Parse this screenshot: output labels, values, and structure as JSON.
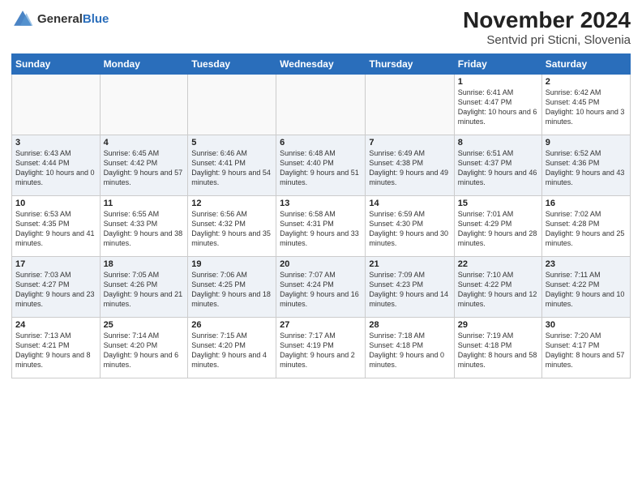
{
  "header": {
    "logo_general": "General",
    "logo_blue": "Blue",
    "title": "November 2024",
    "subtitle": "Sentvid pri Sticni, Slovenia"
  },
  "days_of_week": [
    "Sunday",
    "Monday",
    "Tuesday",
    "Wednesday",
    "Thursday",
    "Friday",
    "Saturday"
  ],
  "weeks": [
    [
      {
        "day": "",
        "info": ""
      },
      {
        "day": "",
        "info": ""
      },
      {
        "day": "",
        "info": ""
      },
      {
        "day": "",
        "info": ""
      },
      {
        "day": "",
        "info": ""
      },
      {
        "day": "1",
        "info": "Sunrise: 6:41 AM\nSunset: 4:47 PM\nDaylight: 10 hours and 6 minutes."
      },
      {
        "day": "2",
        "info": "Sunrise: 6:42 AM\nSunset: 4:45 PM\nDaylight: 10 hours and 3 minutes."
      }
    ],
    [
      {
        "day": "3",
        "info": "Sunrise: 6:43 AM\nSunset: 4:44 PM\nDaylight: 10 hours and 0 minutes."
      },
      {
        "day": "4",
        "info": "Sunrise: 6:45 AM\nSunset: 4:42 PM\nDaylight: 9 hours and 57 minutes."
      },
      {
        "day": "5",
        "info": "Sunrise: 6:46 AM\nSunset: 4:41 PM\nDaylight: 9 hours and 54 minutes."
      },
      {
        "day": "6",
        "info": "Sunrise: 6:48 AM\nSunset: 4:40 PM\nDaylight: 9 hours and 51 minutes."
      },
      {
        "day": "7",
        "info": "Sunrise: 6:49 AM\nSunset: 4:38 PM\nDaylight: 9 hours and 49 minutes."
      },
      {
        "day": "8",
        "info": "Sunrise: 6:51 AM\nSunset: 4:37 PM\nDaylight: 9 hours and 46 minutes."
      },
      {
        "day": "9",
        "info": "Sunrise: 6:52 AM\nSunset: 4:36 PM\nDaylight: 9 hours and 43 minutes."
      }
    ],
    [
      {
        "day": "10",
        "info": "Sunrise: 6:53 AM\nSunset: 4:35 PM\nDaylight: 9 hours and 41 minutes."
      },
      {
        "day": "11",
        "info": "Sunrise: 6:55 AM\nSunset: 4:33 PM\nDaylight: 9 hours and 38 minutes."
      },
      {
        "day": "12",
        "info": "Sunrise: 6:56 AM\nSunset: 4:32 PM\nDaylight: 9 hours and 35 minutes."
      },
      {
        "day": "13",
        "info": "Sunrise: 6:58 AM\nSunset: 4:31 PM\nDaylight: 9 hours and 33 minutes."
      },
      {
        "day": "14",
        "info": "Sunrise: 6:59 AM\nSunset: 4:30 PM\nDaylight: 9 hours and 30 minutes."
      },
      {
        "day": "15",
        "info": "Sunrise: 7:01 AM\nSunset: 4:29 PM\nDaylight: 9 hours and 28 minutes."
      },
      {
        "day": "16",
        "info": "Sunrise: 7:02 AM\nSunset: 4:28 PM\nDaylight: 9 hours and 25 minutes."
      }
    ],
    [
      {
        "day": "17",
        "info": "Sunrise: 7:03 AM\nSunset: 4:27 PM\nDaylight: 9 hours and 23 minutes."
      },
      {
        "day": "18",
        "info": "Sunrise: 7:05 AM\nSunset: 4:26 PM\nDaylight: 9 hours and 21 minutes."
      },
      {
        "day": "19",
        "info": "Sunrise: 7:06 AM\nSunset: 4:25 PM\nDaylight: 9 hours and 18 minutes."
      },
      {
        "day": "20",
        "info": "Sunrise: 7:07 AM\nSunset: 4:24 PM\nDaylight: 9 hours and 16 minutes."
      },
      {
        "day": "21",
        "info": "Sunrise: 7:09 AM\nSunset: 4:23 PM\nDaylight: 9 hours and 14 minutes."
      },
      {
        "day": "22",
        "info": "Sunrise: 7:10 AM\nSunset: 4:22 PM\nDaylight: 9 hours and 12 minutes."
      },
      {
        "day": "23",
        "info": "Sunrise: 7:11 AM\nSunset: 4:22 PM\nDaylight: 9 hours and 10 minutes."
      }
    ],
    [
      {
        "day": "24",
        "info": "Sunrise: 7:13 AM\nSunset: 4:21 PM\nDaylight: 9 hours and 8 minutes."
      },
      {
        "day": "25",
        "info": "Sunrise: 7:14 AM\nSunset: 4:20 PM\nDaylight: 9 hours and 6 minutes."
      },
      {
        "day": "26",
        "info": "Sunrise: 7:15 AM\nSunset: 4:20 PM\nDaylight: 9 hours and 4 minutes."
      },
      {
        "day": "27",
        "info": "Sunrise: 7:17 AM\nSunset: 4:19 PM\nDaylight: 9 hours and 2 minutes."
      },
      {
        "day": "28",
        "info": "Sunrise: 7:18 AM\nSunset: 4:18 PM\nDaylight: 9 hours and 0 minutes."
      },
      {
        "day": "29",
        "info": "Sunrise: 7:19 AM\nSunset: 4:18 PM\nDaylight: 8 hours and 58 minutes."
      },
      {
        "day": "30",
        "info": "Sunrise: 7:20 AM\nSunset: 4:17 PM\nDaylight: 8 hours and 57 minutes."
      }
    ]
  ]
}
